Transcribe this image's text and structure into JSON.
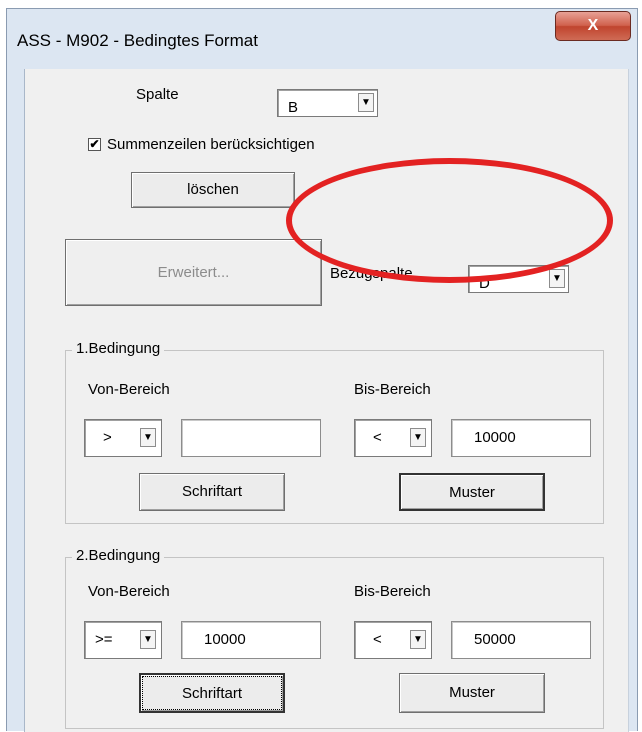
{
  "window": {
    "title": "ASS - M902 - Bedingtes Format",
    "close_glyph": "X"
  },
  "spalte": {
    "label": "Spalte",
    "value": "B"
  },
  "summenzeilen": {
    "label": "Summenzeilen berücksichtigen",
    "checked": true,
    "check_glyph": "✔"
  },
  "loeschen_label": "löschen",
  "erweitert_label": "Erweitert...",
  "bezugspalte": {
    "label": "Bezugspalte",
    "value": "D"
  },
  "combo_arrow_glyph": "▼",
  "bedingung1": {
    "title": "1.Bedingung",
    "von_label": "Von-Bereich",
    "bis_label": "Bis-Bereich",
    "von_operator": ">",
    "von_value": "",
    "bis_operator": "<",
    "bis_value": "10000",
    "schriftart_label": "Schriftart",
    "muster_label": "Muster"
  },
  "bedingung2": {
    "title": "2.Bedingung",
    "von_label": "Von-Bereich",
    "bis_label": "Bis-Bereich",
    "von_operator": ">=",
    "von_value": "10000",
    "bis_operator": "<",
    "bis_value": "50000",
    "schriftart_label": "Schriftart",
    "muster_label": "Muster"
  },
  "colors": {
    "highlight": "#e32222",
    "dialog_bg": "#f0f0f0",
    "frame": "#dce6f2"
  }
}
